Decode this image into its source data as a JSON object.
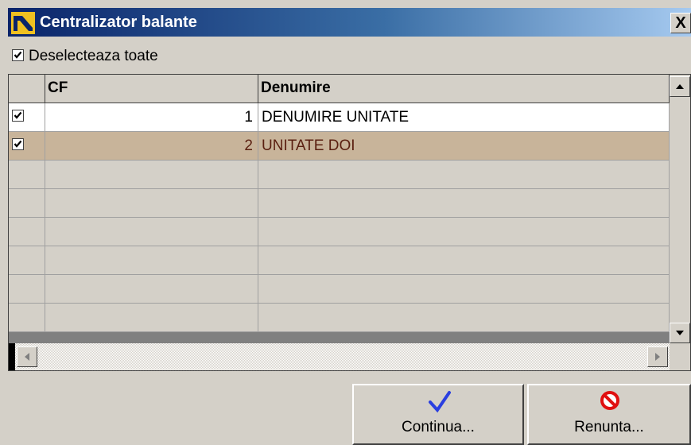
{
  "window": {
    "title": "Centralizator balante",
    "close_label": "X"
  },
  "toolbar": {
    "deselect_label": "Deselecteaza toate",
    "deselect_checked": true
  },
  "grid": {
    "columns": [
      "CF",
      "Denumire"
    ],
    "rows": [
      {
        "checked": true,
        "cf": "1",
        "denumire": "DENUMIRE UNITATE",
        "selected": false
      },
      {
        "checked": true,
        "cf": "2",
        "denumire": "UNITATE DOI",
        "selected": true
      }
    ]
  },
  "buttons": {
    "continue_label": "Continua...",
    "cancel_label": "Renunta..."
  },
  "colors": {
    "title_start": "#0a246a",
    "title_end": "#a6caf0",
    "selected_row": "#c8b49a",
    "selected_text": "#5a1f10"
  }
}
